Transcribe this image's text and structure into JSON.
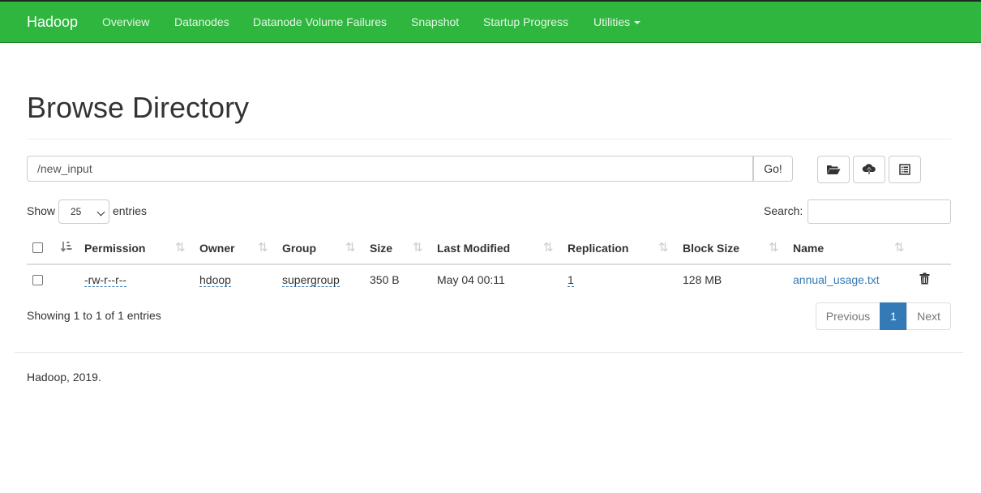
{
  "navbar": {
    "brand": "Hadoop",
    "items": [
      "Overview",
      "Datanodes",
      "Datanode Volume Failures",
      "Snapshot",
      "Startup Progress",
      "Utilities"
    ],
    "color": "#2fb63f"
  },
  "page_title": "Browse Directory",
  "path": {
    "value": "/new_input",
    "go_label": "Go!"
  },
  "toolbar_icons": [
    "folder-open-icon",
    "cloud-upload-icon",
    "list-alt-icon"
  ],
  "length_menu": {
    "show": "Show",
    "value": "25",
    "entries": "entries"
  },
  "search": {
    "label": "Search:",
    "value": ""
  },
  "table": {
    "columns": [
      "Permission",
      "Owner",
      "Group",
      "Size",
      "Last Modified",
      "Replication",
      "Block Size",
      "Name"
    ],
    "rows": [
      {
        "permission": "-rw-r--r--",
        "owner": "hdoop",
        "group": "supergroup",
        "size": "350 B",
        "last_modified": "May 04 00:11",
        "replication": "1",
        "block_size": "128 MB",
        "name": "annual_usage.txt"
      }
    ]
  },
  "info": "Showing 1 to 1 of 1 entries",
  "pagination": {
    "previous": "Previous",
    "current": "1",
    "next": "Next"
  },
  "footer": "Hadoop, 2019."
}
